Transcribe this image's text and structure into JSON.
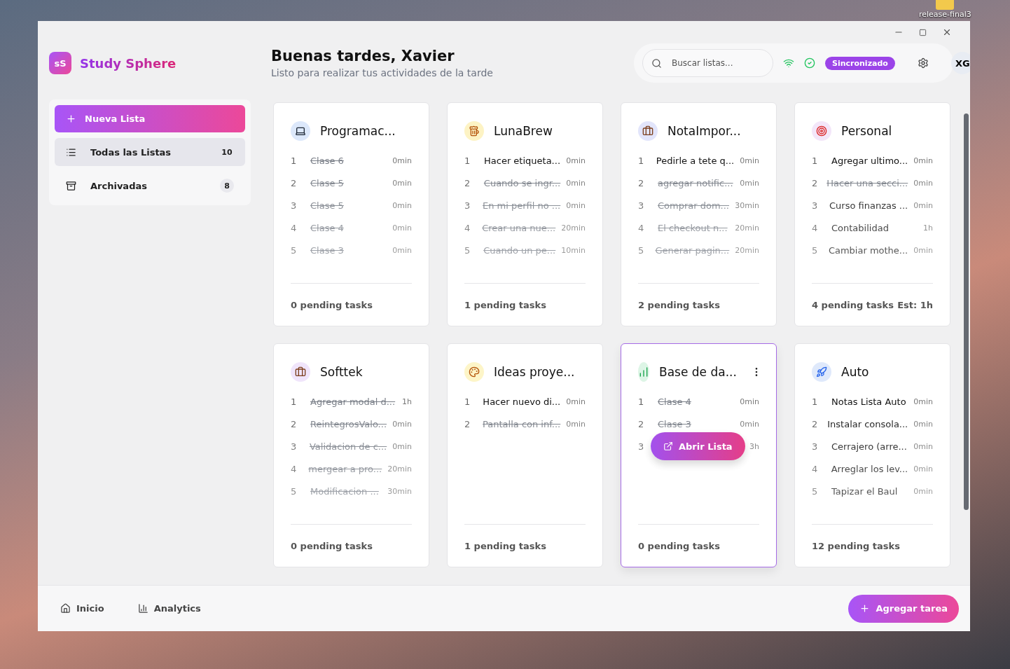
{
  "desktop": {
    "icon_label": "release-final3"
  },
  "app": {
    "logo_mark": "sS",
    "name": "Study Sphere"
  },
  "header": {
    "greeting": "Buenas tardes, Xavier",
    "subtitle": "Listo para realizar tus actividades de la tarde"
  },
  "topbar": {
    "search_placeholder": "Buscar listas...",
    "sync_badge": "Sincronizado",
    "avatar": "XG"
  },
  "sidebar": {
    "new_button": "Nueva Lista",
    "items": [
      {
        "label": "Todas las Listas",
        "count": "10",
        "selected": true
      },
      {
        "label": "Archivadas",
        "count": "8",
        "selected": false
      }
    ]
  },
  "lists": [
    {
      "title": "Programac...",
      "color": "#dce8fb",
      "hovered": false,
      "pending": "0 pending tasks",
      "tasks": [
        {
          "num": "1",
          "title": "Clase 6",
          "time": "0min",
          "done": true
        },
        {
          "num": "2",
          "title": "Clase 5",
          "time": "0min",
          "done": true
        },
        {
          "num": "3",
          "title": "Clase 5",
          "time": "0min",
          "done": true
        },
        {
          "num": "4",
          "title": "Clase 4",
          "time": "0min",
          "done": true
        },
        {
          "num": "5",
          "title": "Clase 3",
          "time": "0min",
          "done": true
        }
      ]
    },
    {
      "title": "LunaBrew",
      "color": "#fdf3c4",
      "hovered": false,
      "pending": "1 pending tasks",
      "tasks": [
        {
          "num": "1",
          "title": "Hacer etiqueta...",
          "time": "0min",
          "done": false
        },
        {
          "num": "2",
          "title": "Cuando se ingr...",
          "time": "0min",
          "done": true
        },
        {
          "num": "3",
          "title": "En mi perfil no ...",
          "time": "0min",
          "done": true
        },
        {
          "num": "4",
          "title": "Crear una nue...",
          "time": "20min",
          "done": true
        },
        {
          "num": "5",
          "title": "Cuando un pe...",
          "time": "10min",
          "done": true
        }
      ]
    },
    {
      "title": "NotaImpor...",
      "color": "#e2e5fb",
      "hovered": false,
      "pending": "2 pending tasks",
      "tasks": [
        {
          "num": "1",
          "title": "Pedirle a tete q...",
          "time": "0min",
          "done": false
        },
        {
          "num": "2",
          "title": "agregar notific...",
          "time": "0min",
          "done": true
        },
        {
          "num": "3",
          "title": "Comprar dom...",
          "time": "30min",
          "done": true
        },
        {
          "num": "4",
          "title": "El checkout n...",
          "time": "20min",
          "done": true
        },
        {
          "num": "5",
          "title": "Generar pagin...",
          "time": "20min",
          "done": true
        }
      ]
    },
    {
      "title": "Personal",
      "color": "#f3e6f9",
      "hovered": false,
      "pending": "4 pending tasks",
      "estimate": "Est: 1h",
      "tasks": [
        {
          "num": "1",
          "title": "Agregar ultimo...",
          "time": "0min",
          "done": false
        },
        {
          "num": "2",
          "title": "Hacer una secci...",
          "time": "0min",
          "done": true
        },
        {
          "num": "3",
          "title": "Curso finanzas ...",
          "time": "0min",
          "done": false
        },
        {
          "num": "4",
          "title": "Contabilidad",
          "time": "1h",
          "done": false
        },
        {
          "num": "5",
          "title": "Cambiar mothe...",
          "time": "0min",
          "done": false
        }
      ]
    },
    {
      "title": "Softtek",
      "color": "#f0e5fb",
      "hovered": false,
      "pending": "0 pending tasks",
      "tasks": [
        {
          "num": "1",
          "title": "Agregar modal d...",
          "time": "1h",
          "done": true
        },
        {
          "num": "2",
          "title": "ReintegrosValo...",
          "time": "0min",
          "done": true
        },
        {
          "num": "3",
          "title": "Validacion de c...",
          "time": "0min",
          "done": true
        },
        {
          "num": "4",
          "title": "mergear a pro...",
          "time": "20min",
          "done": true
        },
        {
          "num": "5",
          "title": "Modificacion ...",
          "time": "30min",
          "done": true
        }
      ]
    },
    {
      "title": "Ideas proye...",
      "color": "#fdf5c8",
      "hovered": false,
      "pending": "1 pending tasks",
      "tasks": [
        {
          "num": "1",
          "title": "Hacer nuevo di...",
          "time": "0min",
          "done": false
        },
        {
          "num": "2",
          "title": "Pantalla con inf...",
          "time": "0min",
          "done": true
        }
      ]
    },
    {
      "title": "Base de da...",
      "color": "#ddf5e6",
      "hovered": true,
      "open_button": "Abrir Lista",
      "pending": "0 pending tasks",
      "tasks": [
        {
          "num": "1",
          "title": "Clase 4",
          "time": "0min",
          "done": true
        },
        {
          "num": "2",
          "title": "Clase 3",
          "time": "0min",
          "done": true
        },
        {
          "num": "3",
          "time": "3h"
        }
      ]
    },
    {
      "title": "Auto",
      "color": "#dfe9fb",
      "hovered": false,
      "pending": "12 pending tasks",
      "tasks": [
        {
          "num": "1",
          "title": "Notas Lista Auto",
          "time": "0min",
          "done": false
        },
        {
          "num": "2",
          "title": "Instalar consola...",
          "time": "0min",
          "done": false
        },
        {
          "num": "3",
          "title": "Cerrajero (arre...",
          "time": "0min",
          "done": false
        },
        {
          "num": "4",
          "title": "Arreglar los lev...",
          "time": "0min",
          "done": false
        },
        {
          "num": "5",
          "title": "Tapizar el Baul",
          "time": "0min",
          "done": false
        }
      ]
    }
  ],
  "footer": {
    "nav": [
      {
        "label": "Inicio",
        "kind": "home"
      },
      {
        "label": "Analytics",
        "kind": "chart"
      }
    ],
    "add_button": "Agregar tarea"
  }
}
